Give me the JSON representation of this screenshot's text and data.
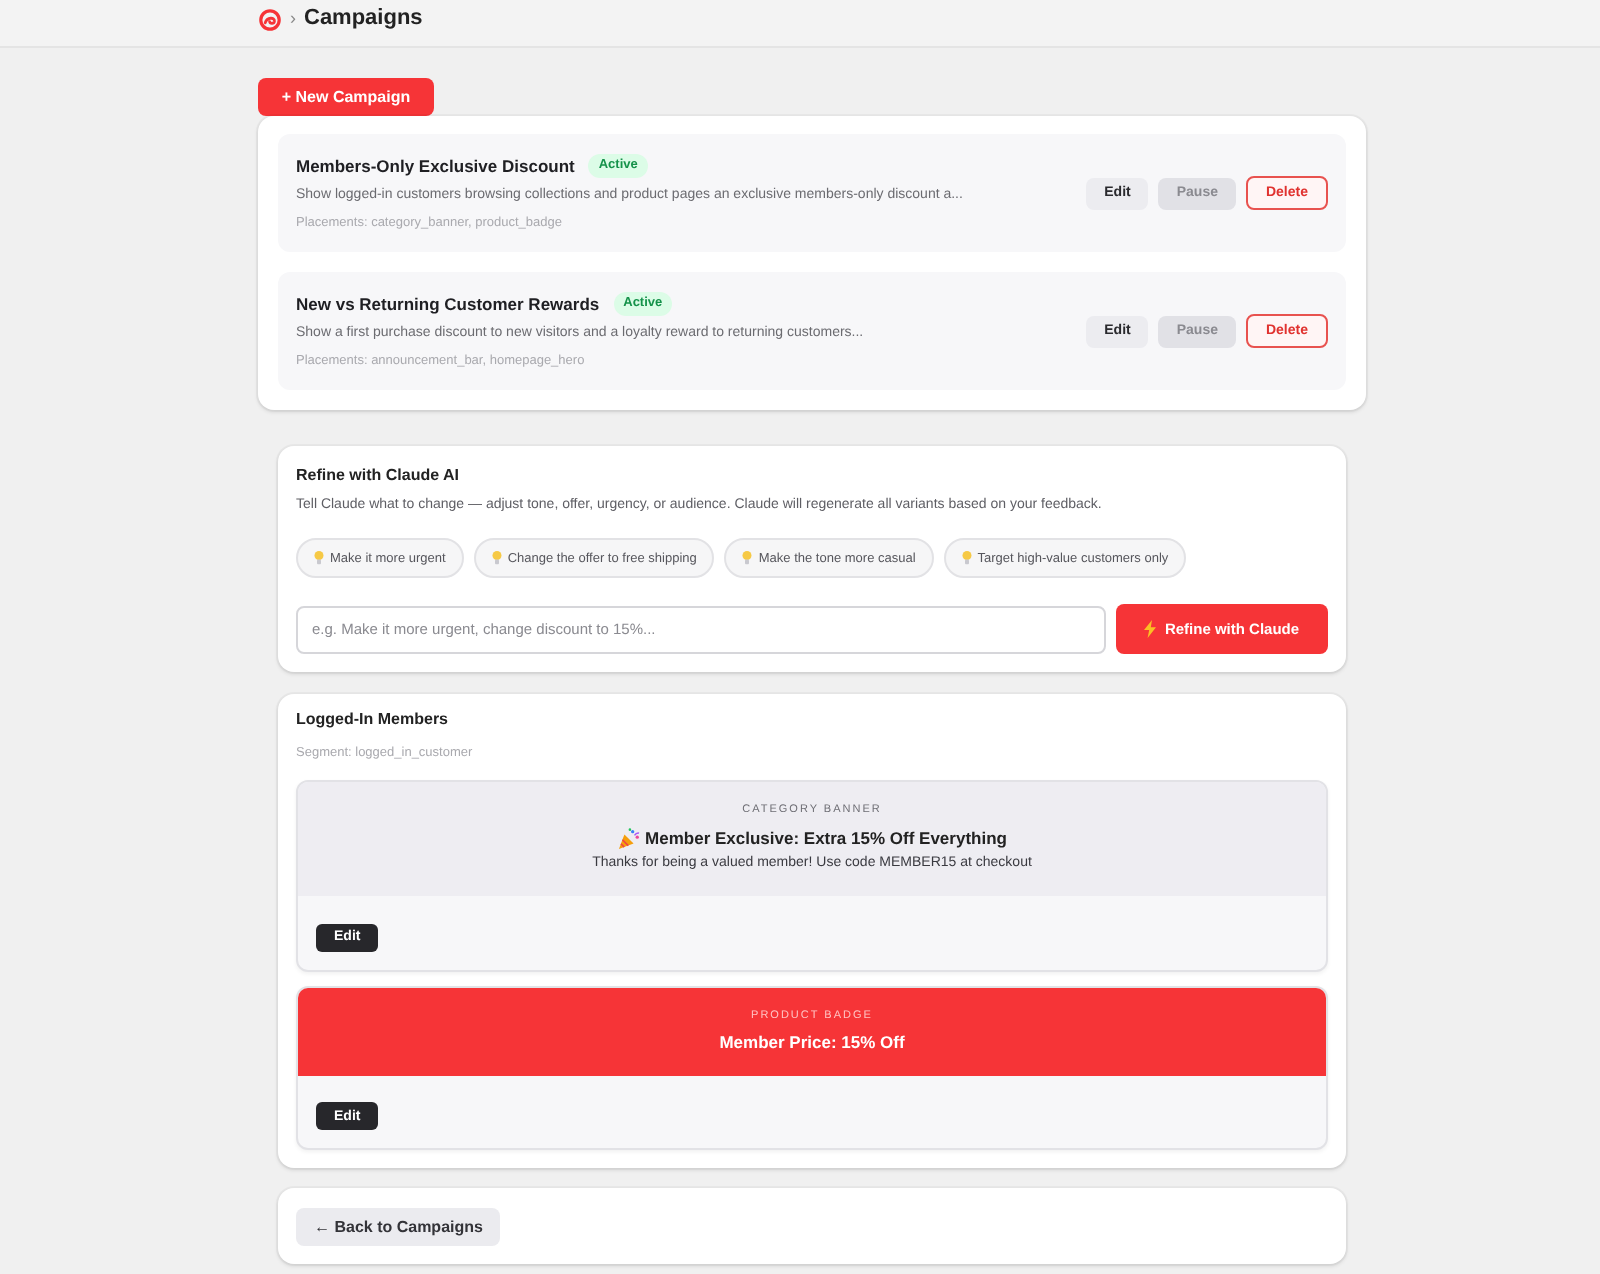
{
  "breadcrumb": {
    "separator": "›",
    "title": "Campaigns"
  },
  "new_campaign_button": "+ New Campaign",
  "campaigns": [
    {
      "title": "Members-Only Exclusive Discount",
      "status": "Active",
      "description": "Show logged-in customers browsing collections and product pages an exclusive members-only discount a...",
      "placements": "Placements: category_banner, product_badge",
      "actions": [
        {
          "label": "Edit",
          "kind": "edit"
        },
        {
          "label": "Pause",
          "kind": "pause"
        },
        {
          "label": "Delete",
          "kind": "delete"
        }
      ]
    },
    {
      "title": "New vs Returning Customer Rewards",
      "status": "Active",
      "description": "Show a first purchase discount to new visitors and a loyalty reward to returning customers...",
      "placements": "Placements: announcement_bar, homepage_hero",
      "actions": [
        {
          "label": "Edit",
          "kind": "edit"
        },
        {
          "label": "Pause",
          "kind": "pause"
        },
        {
          "label": "Delete",
          "kind": "delete"
        }
      ]
    }
  ],
  "refine": {
    "title": "Refine with Claude AI",
    "description": "Tell Claude what to change — adjust tone, offer, urgency, or audience. Claude will regenerate all variants based on your feedback.",
    "suggestions": [
      "Make it more urgent",
      "Change the offer to free shipping",
      "Make the tone more casual",
      "Target high-value customers only"
    ],
    "input": {
      "placeholder": "e.g. Make it more urgent, change discount to 15%..."
    },
    "button": "Refine with Claude"
  },
  "segment": {
    "title": "Logged-In Members",
    "segment": "Segment: logged_in_customer",
    "previews": [
      {
        "kind": "banner",
        "label": "CATEGORY BANNER",
        "headline": "Member Exclusive: Extra 15% Off Everything",
        "body": "Thanks for being a valued member! Use code MEMBER15 at checkout",
        "edit": "Edit"
      },
      {
        "kind": "badge",
        "label": "PRODUCT BADGE",
        "headline": "Member Price: 15% Off",
        "edit": "Edit"
      }
    ]
  },
  "back_button": "← Back to Campaigns"
}
